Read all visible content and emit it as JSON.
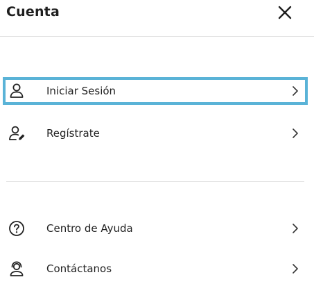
{
  "header": {
    "title": "Cuenta",
    "close_icon": "close-icon"
  },
  "menu": {
    "account_items": [
      {
        "label": "Iniciar Sesión",
        "icon": "user-icon",
        "highlighted": true
      },
      {
        "label": "Regístrate",
        "icon": "user-edit-icon",
        "highlighted": false
      }
    ],
    "support_items": [
      {
        "label": "Centro de Ayuda",
        "icon": "question-circle-icon"
      },
      {
        "label": "Contáctanos",
        "icon": "contact-support-icon"
      }
    ]
  },
  "colors": {
    "highlight_border": "#5ab3d7",
    "text": "#222222",
    "divider": "#e3e3e3"
  }
}
